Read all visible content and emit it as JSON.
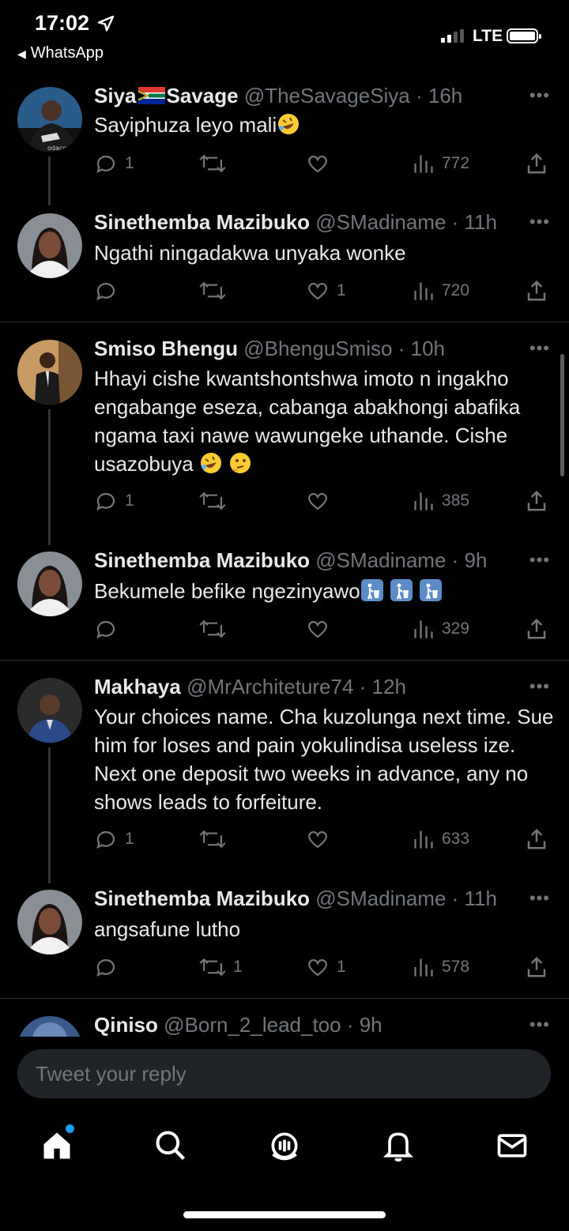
{
  "status_bar": {
    "time": "17:02",
    "back_app": "WhatsApp",
    "network": "LTE"
  },
  "tweets": [
    {
      "name_part1": "Siya",
      "name_part2": "Savage",
      "handle": "@TheSavageSiya",
      "time": "16h",
      "text": "Sayiphuza leyo mali",
      "emojis": [
        "rofl"
      ],
      "replies": "1",
      "retweets": "",
      "likes": "",
      "views": "772"
    },
    {
      "name": "Sinethemba Mazibuko",
      "handle": "@SMadiname",
      "time": "11h",
      "text": "Ngathi ningadakwa unyaka wonke",
      "replies": "",
      "retweets": "",
      "likes": "1",
      "views": "720"
    },
    {
      "name": "Smiso Bhengu",
      "handle": "@BhenguSmiso",
      "time": "10h",
      "text": "Hhayi cishe kwantshontshwa imoto n ingakho engabange eseza, cabanga abakhongi abafika ngama taxi nawe wawungeke uthande. Cishe usazobuya",
      "emojis": [
        "rofl",
        "thinking"
      ],
      "replies": "1",
      "retweets": "",
      "likes": "",
      "views": "385"
    },
    {
      "name": "Sinethemba Mazibuko",
      "handle": "@SMadiname",
      "time": "9h",
      "text": "Bekumele befike ngezinyawo",
      "emojis": [
        "litter",
        "litter",
        "litter"
      ],
      "replies": "",
      "retweets": "",
      "likes": "",
      "views": "329"
    },
    {
      "name": "Makhaya",
      "handle": "@MrArchiteture74",
      "time": "12h",
      "text": "Your choices name. Cha kuzolunga next time. Sue him for loses and pain yokulindisa useless ize. Next one deposit two weeks in advance, any no shows leads to forfeiture.",
      "replies": "1",
      "retweets": "",
      "likes": "",
      "views": "633"
    },
    {
      "name": "Sinethemba Mazibuko",
      "handle": "@SMadiname",
      "time": "11h",
      "text": "angsafune lutho",
      "replies": "",
      "retweets": "1",
      "likes": "1",
      "views": "578"
    },
    {
      "name": "Qiniso",
      "handle": "@Born_2_lead_too",
      "time": "9h"
    }
  ],
  "reply_box": {
    "placeholder": "Tweet your reply"
  },
  "tabs": [
    "home-icon",
    "search-icon",
    "spaces-icon",
    "notifications-icon",
    "messages-icon"
  ],
  "colors": {
    "accent": "#1d9bf0",
    "muted": "#71767b",
    "text": "#e7e9ea",
    "divider": "#2f3336"
  }
}
